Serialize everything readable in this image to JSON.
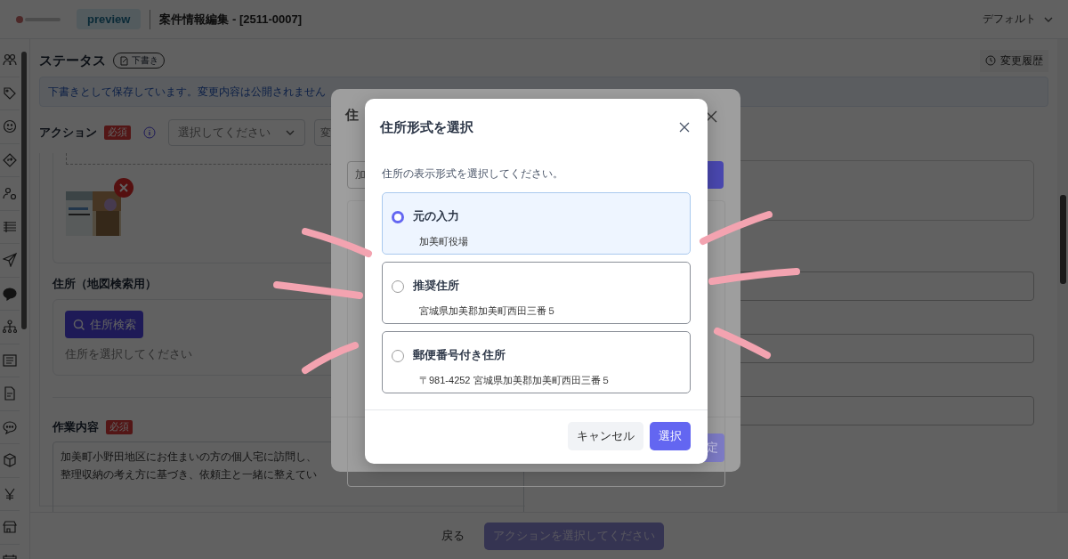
{
  "header": {
    "preview_badge": "preview",
    "title": "案件情報編集 - [2511-0007]",
    "view_select": "デフォルト"
  },
  "status": {
    "label": "ステータス",
    "chip": "下書き",
    "history_button": "変更履歴"
  },
  "notice": "下書きとして保存しています。変更内容は公開されません",
  "action": {
    "label": "アクション",
    "required": "必須",
    "select_placeholder": "選択してください",
    "second_select": "変"
  },
  "form": {
    "address_label": "住所（地図検索用）",
    "address_search": "住所検索",
    "address_hint": "住所を選択してください",
    "work_label": "作業内容",
    "work_required": "必須",
    "work_lines": [
      "加美町小野田地区にお住まいの方の個人宅に訪問し、",
      "整理収納の考え方に基づき、依頼主と一緒に整えてい"
    ]
  },
  "footer": {
    "back": "戻る",
    "submit": "アクションを選択してください",
    "submit_disabled": true
  },
  "background_dialog": {
    "title": "住",
    "search_value": "加",
    "confirm": "定"
  },
  "dialog": {
    "title": "住所形式を選択",
    "description": "住所の表示形式を選択してください。",
    "options": [
      {
        "label": "元の入力",
        "address": "加美町役場",
        "selected": true
      },
      {
        "label": "推奨住所",
        "address": "宮城県加美郡加美町西田三番５",
        "selected": false
      },
      {
        "label": "郵便番号付き住所",
        "address": "〒981-4252 宮城県加美郡加美町西田三番５",
        "selected": false
      }
    ],
    "cancel": "キャンセル",
    "select": "選択"
  }
}
